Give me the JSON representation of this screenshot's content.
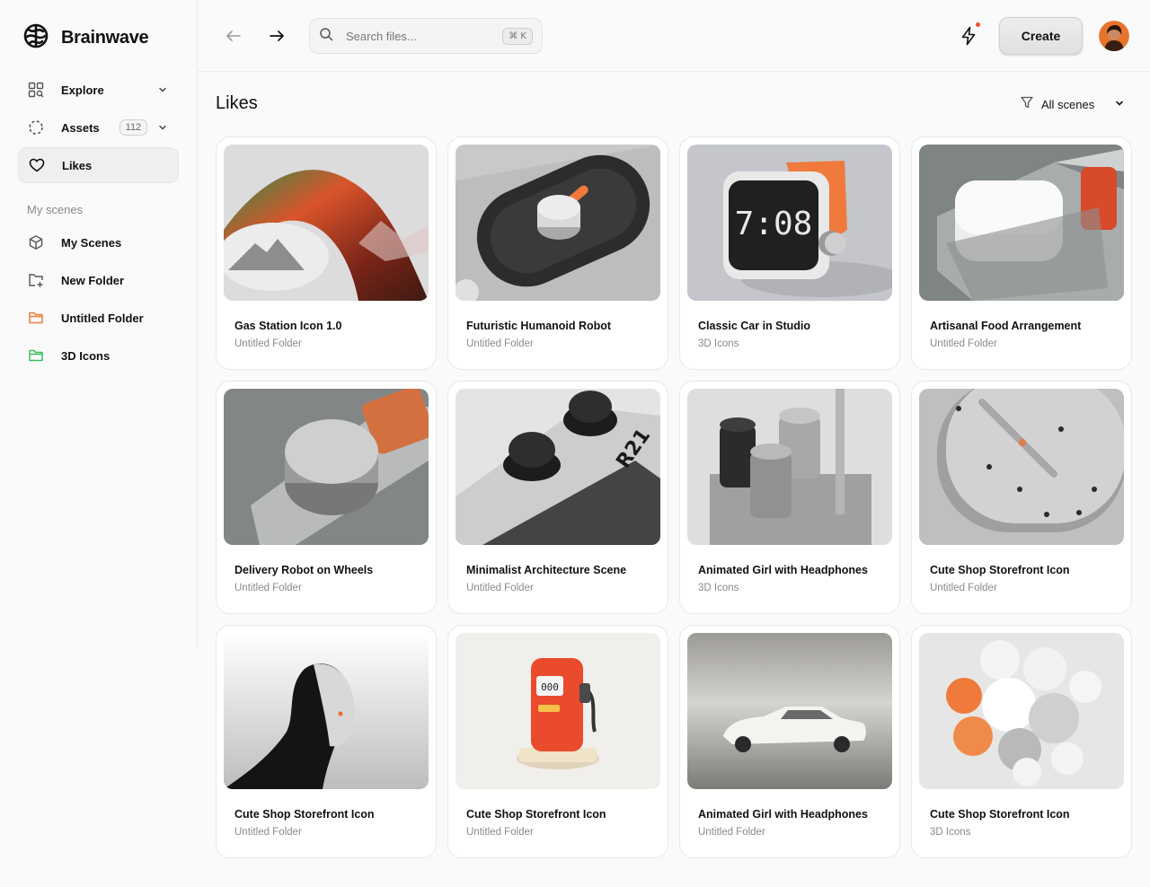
{
  "brand": {
    "name": "Brainwave"
  },
  "sidebar": {
    "nav": [
      {
        "label": "Explore",
        "icon": "grid-search-icon",
        "has_chevron": true
      },
      {
        "label": "Assets",
        "icon": "dashed-circle-icon",
        "badge": "112",
        "has_chevron": true
      },
      {
        "label": "Likes",
        "icon": "heart-icon",
        "active": true
      }
    ],
    "section_label": "My scenes",
    "scenes": [
      {
        "label": "My Scenes",
        "icon": "cube-icon"
      },
      {
        "label": "New Folder",
        "icon": "folder-plus-icon"
      },
      {
        "label": "Untitled Folder",
        "icon": "folder-orange-icon",
        "color": "#f07a3c"
      },
      {
        "label": "3D Icons",
        "icon": "folder-green-icon",
        "color": "#3fbf5f"
      }
    ]
  },
  "topbar": {
    "search_placeholder": "Search files...",
    "shortcut": "⌘ K",
    "create_label": "Create",
    "notification_dot_color": "#ef4b3a"
  },
  "main": {
    "title": "Likes",
    "filter_label": "All scenes",
    "cards": [
      {
        "title": "Gas Station Icon 1.0",
        "folder": "Untitled Folder",
        "thumb": "wave"
      },
      {
        "title": "Futuristic Humanoid Robot",
        "folder": "Untitled Folder",
        "thumb": "slot"
      },
      {
        "title": "Classic Car in Studio",
        "folder": "3D Icons",
        "thumb": "clock"
      },
      {
        "title": "Artisanal Food Arrangement",
        "folder": "Untitled Folder",
        "thumb": "box"
      },
      {
        "title": "Delivery Robot on Wheels",
        "folder": "Untitled Folder",
        "thumb": "knob"
      },
      {
        "title": "Minimalist Architecture Scene",
        "folder": "Untitled Folder",
        "thumb": "gamepad"
      },
      {
        "title": "Animated Girl with Headphones",
        "folder": "3D Icons",
        "thumb": "pins"
      },
      {
        "title": "Cute Shop Storefront Icon",
        "folder": "Untitled Folder",
        "thumb": "dial"
      },
      {
        "title": "Cute Shop Storefront Icon",
        "folder": "Untitled Folder",
        "thumb": "head"
      },
      {
        "title": "Cute Shop Storefront Icon",
        "folder": "Untitled Folder",
        "thumb": "pump"
      },
      {
        "title": "Animated Girl with Headphones",
        "folder": "Untitled Folder",
        "thumb": "car"
      },
      {
        "title": "Cute Shop Storefront Icon",
        "folder": "3D Icons",
        "thumb": "spheres"
      }
    ]
  }
}
